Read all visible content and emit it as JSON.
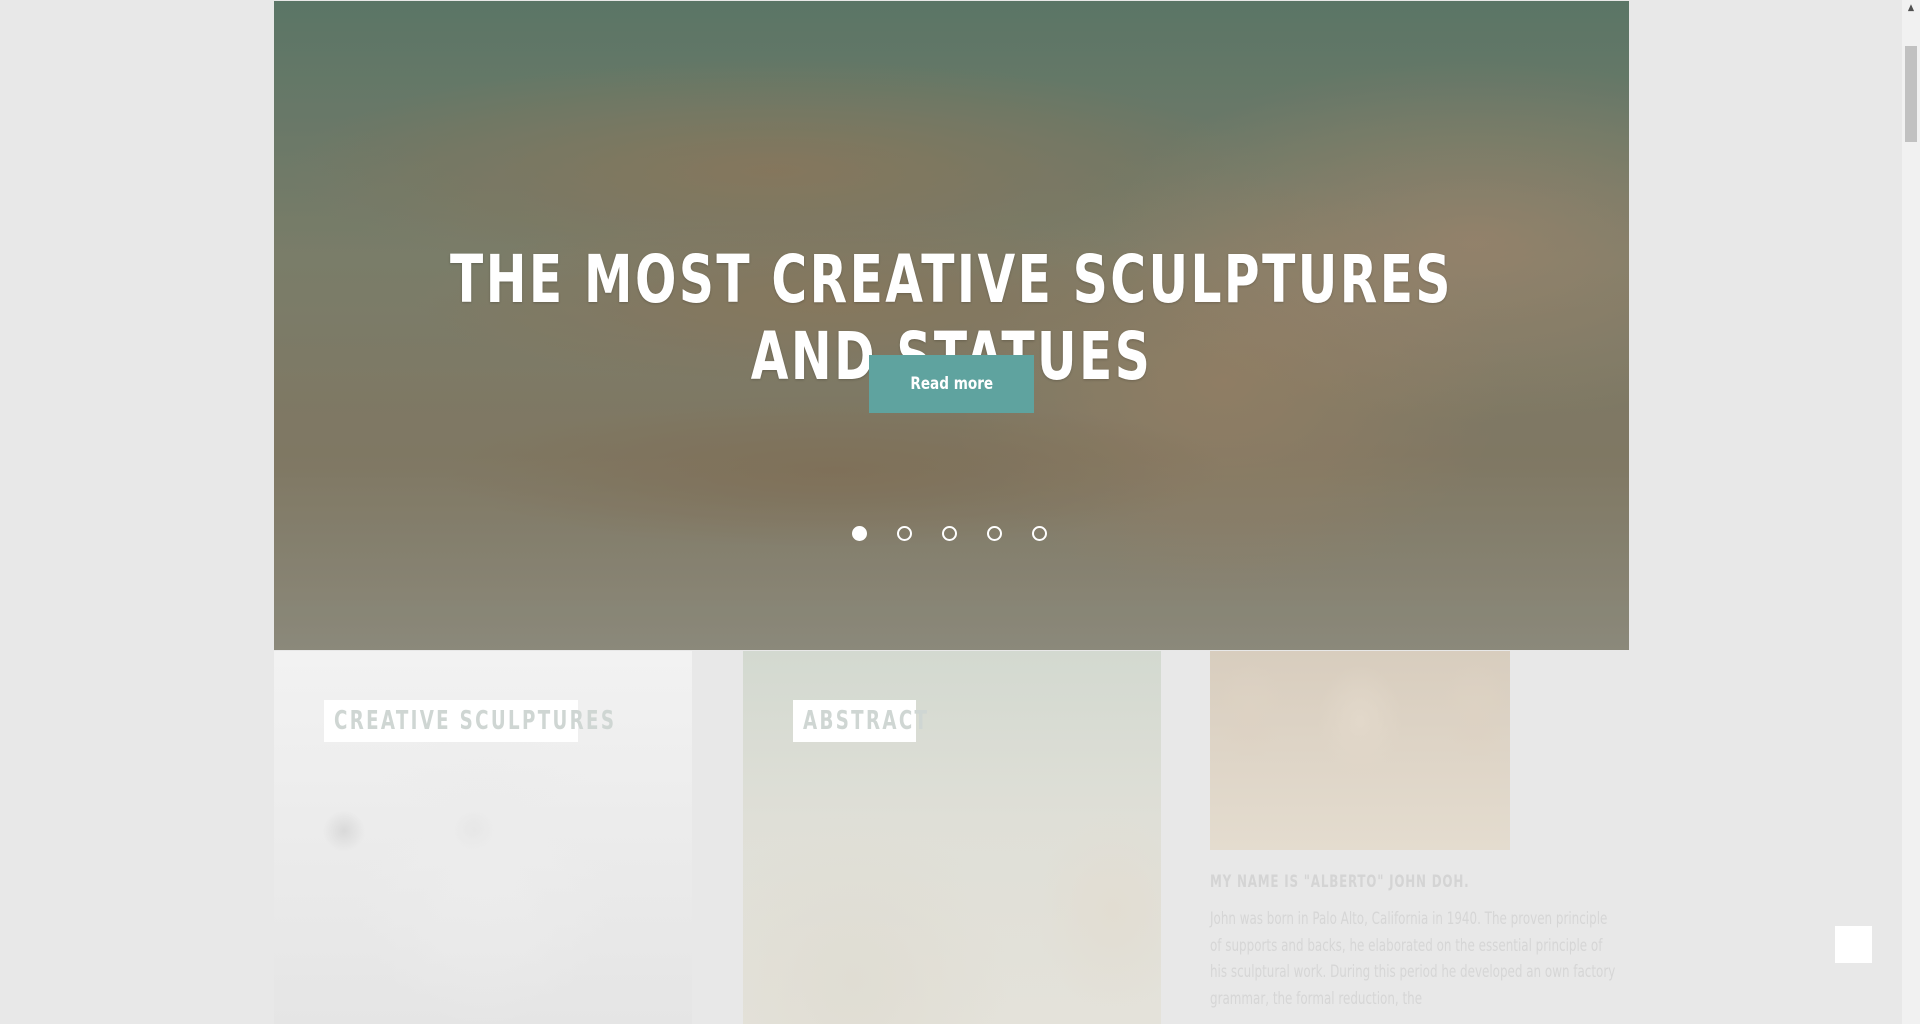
{
  "hero": {
    "title": "THE MOST CREATIVE SCULPTURES AND STATUES",
    "button_label": "Read more",
    "slides_count": 5,
    "active_slide": 1
  },
  "cards": [
    {
      "label": "CREATIVE SCULPTURES"
    },
    {
      "label": "ABSTRACT"
    }
  ],
  "about": {
    "heading": "MY NAME IS \"ALBERTO\" JOHN DOH.",
    "text": "John was born in Palo Alto, California in 1940. The proven principle of supports and backs, he elaborated on the essential principle of his sculptural work. During this period he developed an own factory grammar, the formal reduction, the"
  },
  "scrollbar": {
    "up_arrow": "▲"
  },
  "colors": {
    "accent": "#5fa39f",
    "background": "#e8e8e8",
    "hero_text": "#ffffff"
  }
}
